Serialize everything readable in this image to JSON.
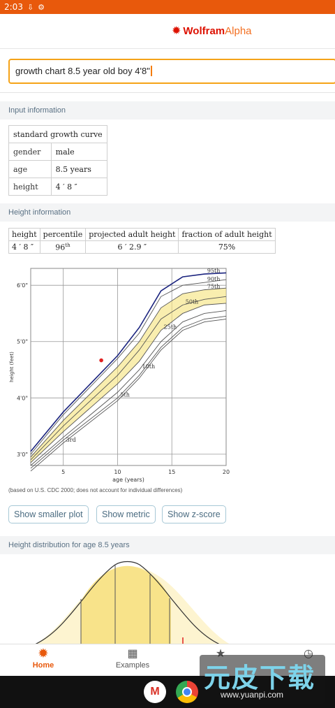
{
  "status": {
    "time": "2:03"
  },
  "brand": {
    "wolfram": "Wolfram",
    "alpha": "Alpha"
  },
  "search": {
    "query": "growth chart 8.5 year old boy 4'8\""
  },
  "input_info": {
    "title": "Input information",
    "header": "standard growth curve",
    "rows": [
      {
        "label": "gender",
        "value": "male"
      },
      {
        "label": "age",
        "value": "8.5 years"
      },
      {
        "label": "height",
        "value": "4 ′ 8 ″"
      }
    ]
  },
  "height_info": {
    "title": "Height information",
    "headers": [
      "height",
      "percentile",
      "projected adult height",
      "fraction of adult height"
    ],
    "values": {
      "height": "4 ′ 8 ″",
      "percentile": "96",
      "percentile_suffix": "th",
      "projected": "6 ′ 2.9 ″",
      "fraction": "75%"
    }
  },
  "chart_data": {
    "type": "line",
    "xlabel": "age (years)",
    "ylabel": "height (feet)",
    "xlim": [
      2,
      20
    ],
    "ylim": [
      2.8,
      6.3
    ],
    "x_ticks": [
      "5",
      "10",
      "15",
      "20"
    ],
    "y_ticks": [
      "3'0\"",
      "4'0\"",
      "5'0\"",
      "6'0\""
    ],
    "x": [
      2,
      5,
      10,
      12,
      14,
      16,
      18,
      20
    ],
    "series": [
      {
        "name": "3rd",
        "values": [
          2.7,
          3.2,
          3.95,
          4.35,
          4.85,
          5.2,
          5.35,
          5.4
        ]
      },
      {
        "name": "5th",
        "values": [
          2.75,
          3.25,
          4.0,
          4.4,
          4.9,
          5.25,
          5.4,
          5.45
        ]
      },
      {
        "name": "10th",
        "values": [
          2.8,
          3.3,
          4.1,
          4.5,
          5.0,
          5.35,
          5.5,
          5.55
        ]
      },
      {
        "name": "25th",
        "values": [
          2.85,
          3.4,
          4.25,
          4.65,
          5.2,
          5.5,
          5.65,
          5.68
        ]
      },
      {
        "name": "50th",
        "values": [
          2.9,
          3.5,
          4.4,
          4.85,
          5.4,
          5.65,
          5.75,
          5.8
        ]
      },
      {
        "name": "75th",
        "values": [
          2.95,
          3.6,
          4.55,
          5.0,
          5.6,
          5.85,
          5.92,
          5.95
        ]
      },
      {
        "name": "90th",
        "values": [
          3.0,
          3.7,
          4.7,
          5.15,
          5.8,
          6.0,
          6.05,
          6.1
        ]
      },
      {
        "name": "95th",
        "values": [
          3.05,
          3.75,
          4.75,
          5.25,
          5.9,
          6.15,
          6.2,
          6.22
        ]
      }
    ],
    "point": {
      "x": 8.5,
      "y": 4.667,
      "color": "#e02020"
    },
    "colors": {
      "band": "#f5e27a",
      "line": "#555555",
      "top": "#1a237e"
    }
  },
  "plot_note": "(based on U.S. CDC 2000; does not account for individual differences)",
  "buttons": {
    "smaller": "Show smaller plot",
    "metric": "Show metric",
    "zscore": "Show z-score"
  },
  "distribution": {
    "title": "Height distribution for age 8.5 years"
  },
  "nav": {
    "home": "Home",
    "examples": "Examples"
  },
  "watermark": {
    "big": "元皮下载",
    "small": "www.yuanpi.com"
  }
}
